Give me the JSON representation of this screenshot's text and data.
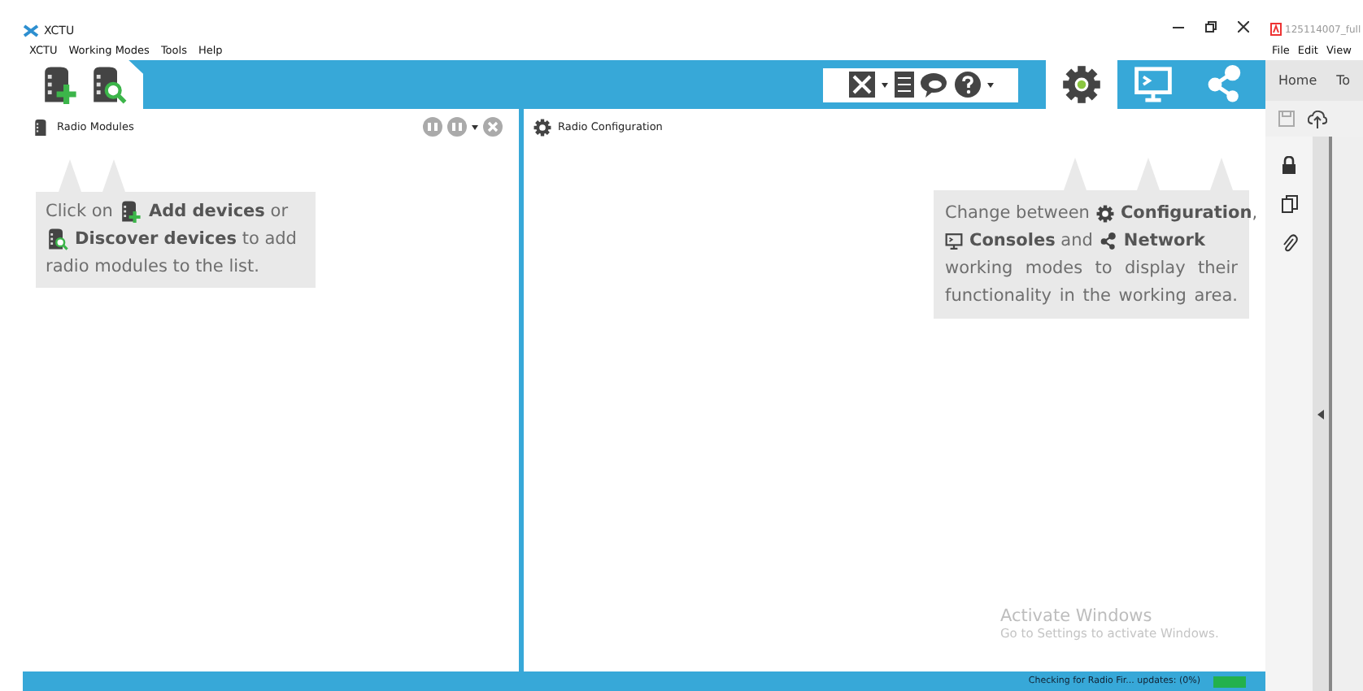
{
  "window": {
    "title": "XCTU",
    "menu": [
      "XCTU",
      "Working Modes",
      "Tools",
      "Help"
    ]
  },
  "toolbar": {
    "modes": [
      {
        "kind": "configuration",
        "selected": true
      },
      {
        "kind": "consoles",
        "selected": false
      },
      {
        "kind": "network",
        "selected": false
      }
    ]
  },
  "radio_modules": {
    "title": "Radio Modules",
    "hint": [
      [
        {
          "kind": "text",
          "text": "Click on"
        },
        {
          "kind": "add"
        },
        {
          "kind": "text",
          "text": "**Add devices** or"
        }
      ],
      [
        {
          "kind": "discover"
        },
        {
          "kind": "text",
          "text": "**Discover devices** to add"
        }
      ],
      [
        {
          "kind": "text",
          "text": "radio modules to the list."
        }
      ]
    ]
  },
  "radio_configuration": {
    "title": "Radio Configuration",
    "hint": [
      [
        {
          "kind": "text",
          "text": "Change between"
        },
        {
          "kind": "configuration"
        },
        {
          "kind": "text",
          "text": "**Configuration**,"
        }
      ],
      [
        {
          "kind": "consoles"
        },
        {
          "kind": "text",
          "text": "**Consoles** and"
        },
        {
          "kind": "network"
        },
        {
          "kind": "text",
          "text": "**Network**"
        }
      ],
      [
        {
          "kind": "text",
          "text": "working modes to display their"
        }
      ],
      [
        {
          "kind": "text",
          "text": "functionality in the working area."
        }
      ]
    ]
  },
  "activation_notice": {
    "title": "Activate Windows",
    "text": "Go to Settings to activate Windows."
  },
  "status_bar": {
    "text": "Checking for Radio Fir... updates: (0%)",
    "level": 1
  },
  "other_window": {
    "title": "125114007_full",
    "menu": [
      "File",
      "Edit",
      "View"
    ],
    "tabs": [
      "Home",
      "To"
    ]
  }
}
